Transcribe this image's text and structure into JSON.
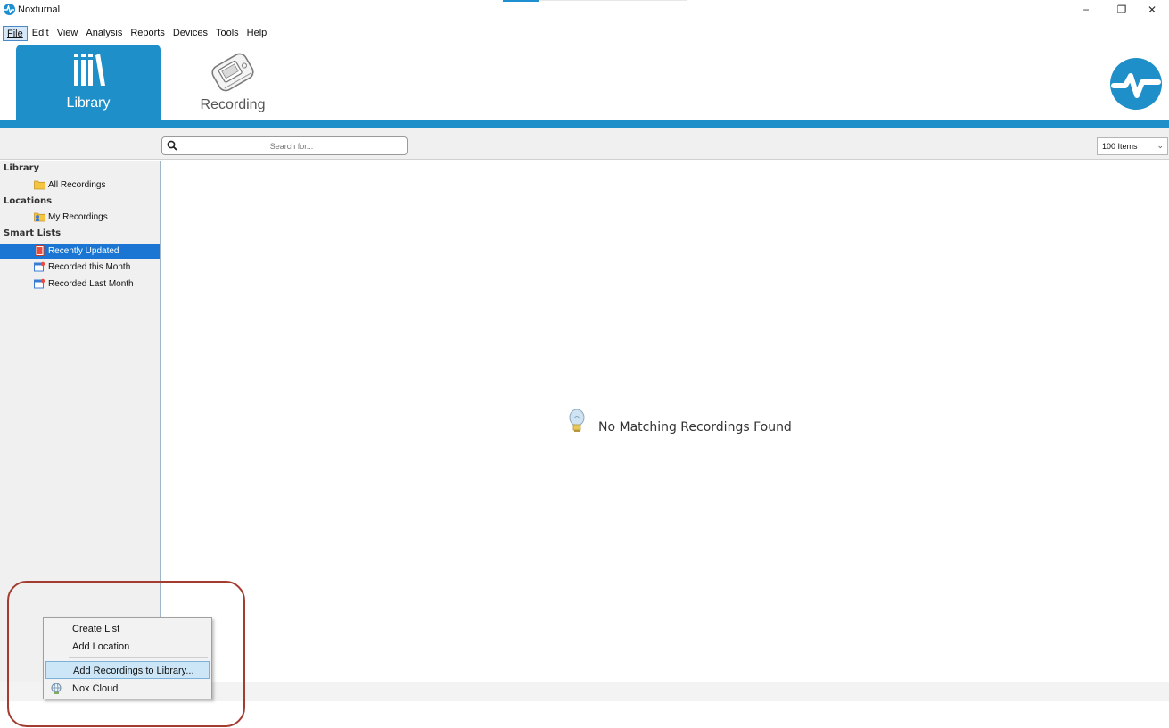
{
  "window": {
    "title": "Noxturnal",
    "minimize_glyph": "−",
    "restore_glyph": "❐",
    "close_glyph": "✕"
  },
  "menu": {
    "items": [
      {
        "label": "File",
        "active": true
      },
      {
        "label": "Edit"
      },
      {
        "label": "View"
      },
      {
        "label": "Analysis"
      },
      {
        "label": "Reports"
      },
      {
        "label": "Devices"
      },
      {
        "label": "Tools"
      },
      {
        "label": "Help"
      }
    ]
  },
  "ribbon": {
    "library_label": "Library",
    "recording_label": "Recording",
    "accent_color": "#1f8fc9"
  },
  "toolbar": {
    "search_placeholder": "Search for...",
    "items_select_value": "100 Items"
  },
  "sidebar": {
    "library_header": "Library",
    "all_recordings": "All Recordings",
    "locations_header": "Locations",
    "my_recordings": "My Recordings",
    "smart_lists_header": "Smart Lists",
    "recently_updated": "Recently Updated",
    "recorded_this_month": "Recorded this Month",
    "recorded_last_month": "Recorded Last Month"
  },
  "main": {
    "empty_message": "No Matching Recordings Found"
  },
  "context_menu": {
    "create_list": "Create List",
    "add_location": "Add Location",
    "add_recordings": "Add Recordings to Library...",
    "nox_cloud": "Nox Cloud"
  },
  "colors": {
    "brand_blue": "#1f8fc9",
    "selection_blue": "#1a76d2",
    "highlight_red": "#a33b2f"
  }
}
